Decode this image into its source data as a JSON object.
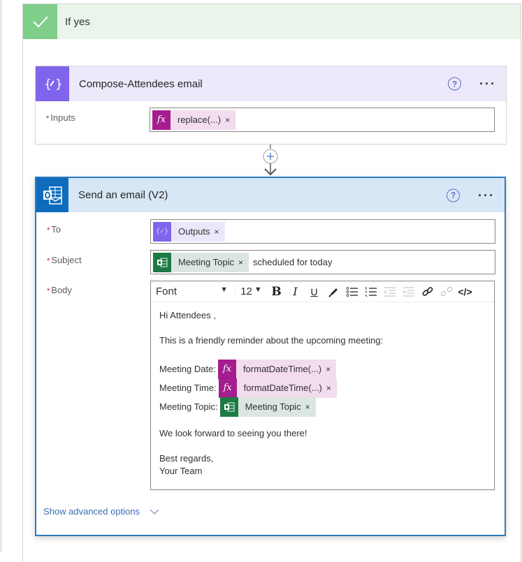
{
  "branch": {
    "title": "If yes",
    "icon": "checkmark-icon",
    "color": "#7fce8a"
  },
  "compose_card": {
    "title": "Compose-Attendees email",
    "icon": "compose-variable-icon",
    "color": "#8065ec",
    "help_label": "?",
    "more_label": "···",
    "fields": {
      "inputs": {
        "label": "Inputs",
        "required_mark": "*",
        "tokens": [
          {
            "type": "expression",
            "icon_text": "fx",
            "label": "replace(...)",
            "remove": "×"
          }
        ]
      }
    }
  },
  "connector": {
    "add_icon": "plus-circle-icon",
    "arrow": "arrow-down-icon"
  },
  "email_card": {
    "title": "Send an email (V2)",
    "icon": "outlook-icon",
    "color": "#0f6cbd",
    "help_label": "?",
    "more_label": "···",
    "fields": {
      "to": {
        "label": "To",
        "required_mark": "*",
        "token": {
          "type": "compose",
          "icon_text": "{✓}",
          "label": "Outputs",
          "remove": "×"
        }
      },
      "subject": {
        "label": "Subject",
        "required_mark": "*",
        "token": {
          "type": "excel",
          "label": "Meeting Topic",
          "remove": "×"
        },
        "text": "scheduled for today"
      },
      "body": {
        "label": "Body",
        "required_mark": "*",
        "toolbar": {
          "font": "Font",
          "font_caret": "▼",
          "size": "12",
          "size_caret": "▼",
          "bold": "B",
          "italic": "I",
          "underline": "U",
          "highlight": "highlight-pen-icon",
          "bullets": "bullet-list-icon",
          "numbered": "numbered-list-icon",
          "outdent": "decrease-indent-icon",
          "indent": "increase-indent-icon",
          "link": "link-icon",
          "unlink": "unlink-icon",
          "code": "</>"
        },
        "greeting": "Hi Attendees ,",
        "intro": "This is a friendly reminder about the upcoming meeting:",
        "rows": [
          {
            "label": "Meeting Date:",
            "token": {
              "type": "expression",
              "icon_text": "fx",
              "label": "formatDateTime(...)",
              "remove": "×"
            }
          },
          {
            "label": "Meeting Time:",
            "token": {
              "type": "expression",
              "icon_text": "fx",
              "label": "formatDateTime(...)",
              "remove": "×"
            }
          },
          {
            "label": "Meeting Topic:",
            "token": {
              "type": "excel",
              "label": "Meeting Topic",
              "remove": "×"
            }
          }
        ],
        "closing": "We look forward to seeing you there!",
        "signoff_1": "Best regards,",
        "signoff_2": "Your Team"
      }
    },
    "advanced_label": "Show advanced options",
    "advanced_icon": "chevron-down-icon"
  }
}
